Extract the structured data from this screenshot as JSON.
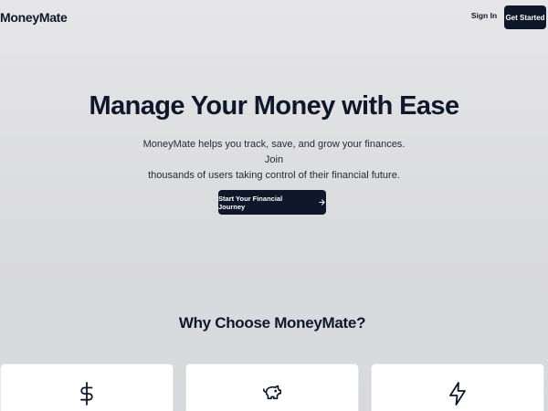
{
  "header": {
    "logo": "MoneyMate",
    "sign_in": "Sign In",
    "get_started": "Get Started"
  },
  "hero": {
    "title": "Manage Your Money with Ease",
    "subtitle_line1": "MoneyMate helps you track, save, and grow your finances. Join",
    "subtitle_line2": "thousands of users taking control of their financial future.",
    "cta_label": "Start Your Financial Journey",
    "cta_icon": "arrow-right-icon"
  },
  "features": {
    "title": "Why Choose MoneyMate?",
    "cards": [
      {
        "icon": "dollar-icon"
      },
      {
        "icon": "piggy-bank-icon"
      },
      {
        "icon": "lightning-icon"
      }
    ]
  },
  "colors": {
    "primary": "#0f172a",
    "background": "#e0e1e3",
    "card": "#ffffff"
  }
}
